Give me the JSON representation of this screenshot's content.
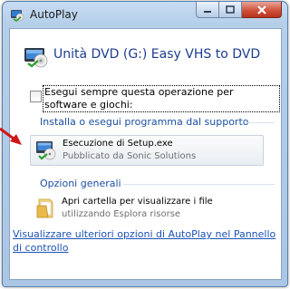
{
  "window": {
    "title": "AutoPlay",
    "buttons": {
      "minimize": "minimize-icon",
      "maximize": "maximize-icon",
      "close": "close-icon"
    }
  },
  "header": {
    "title": "Unità DVD (G:) Easy VHS to DVD",
    "icon": "dvd-drive-icon"
  },
  "always_checkbox": {
    "label": "Esegui sempre questa operazione per software e giochi:",
    "checked": false
  },
  "sections": {
    "install": {
      "title": "Installa o esegui programma dal supporto",
      "options": [
        {
          "main": "Esecuzione di Setup.exe",
          "sub": "Pubblicato da Sonic Solutions",
          "icon": "setup-installer-icon"
        }
      ]
    },
    "general": {
      "title": "Opzioni generali",
      "options": [
        {
          "main": "Apri cartella per visualizzare i file",
          "sub": "utilizzando Esplora risorse",
          "icon": "folder-icon"
        }
      ]
    }
  },
  "footer_link": "Visualizzare ulteriori opzioni di AutoPlay nel Pannello di controllo",
  "colors": {
    "title_text": "#1d3d8f",
    "section_text": "#1c4fa1",
    "link": "#1c52b5",
    "close_button": "#c8452f",
    "arrow": "#d01818"
  }
}
